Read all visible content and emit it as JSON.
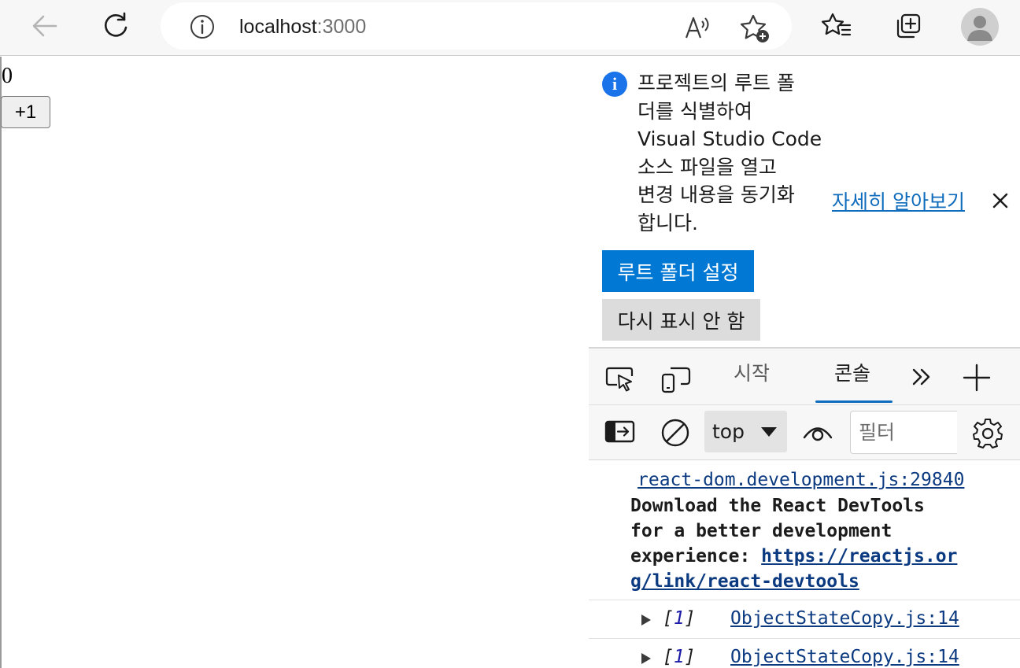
{
  "browser": {
    "url_host": "localhost",
    "url_port": ":3000"
  },
  "page": {
    "count": "0",
    "increment_label": "+1"
  },
  "devtools": {
    "notice": {
      "lines": [
        "프로젝트의 루트 폴",
        "더를 식별하여",
        "Visual Studio Code",
        "소스 파일을 열고",
        "변경 내용을 동기화",
        "합니다."
      ],
      "learn_more": "자세히 알아보기",
      "primary_button": "루트 폴더 설정",
      "secondary_button": "다시 표시 안 함"
    },
    "tabs": {
      "start": "시작",
      "console": "콘솔",
      "active": "console"
    },
    "console_toolbar": {
      "context": "top",
      "filter_placeholder": "필터"
    },
    "messages": {
      "devtools_source": "react-dom.development.js:29840",
      "devtools_text": [
        "Download the React DevTools",
        "for a better development"
      ],
      "devtools_text_prefix": "experience: ",
      "devtools_link_1": "https://reactjs.or",
      "devtools_link_2": "g/link/react-devtools",
      "rows": [
        {
          "open": "[",
          "value": "1",
          "close": "]",
          "source": "ObjectStateCopy.js:14"
        },
        {
          "open": "[",
          "value": "1",
          "close": "]",
          "source": "ObjectStateCopy.js:14"
        }
      ]
    }
  }
}
